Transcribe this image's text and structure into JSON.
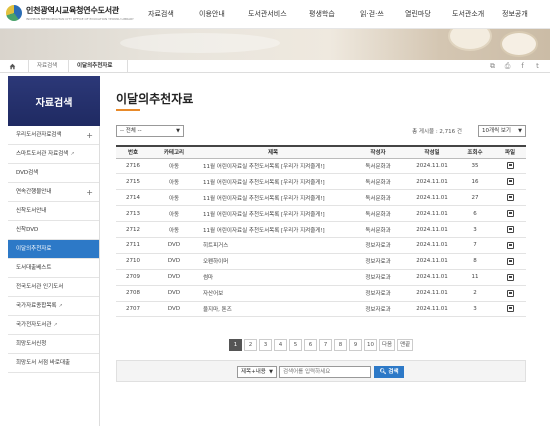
{
  "header": {
    "logo_title": "인천광역시교육청연수도서관",
    "logo_sub": "INCHEON METROPOLITAN CITY OFFICE OF EDUCATION YEONSU LIBRARY",
    "nav": [
      "자료검색",
      "이용안내",
      "도서관서비스",
      "평생학습",
      "읽·걷·쓰",
      "열린마당",
      "도서관소개",
      "정보공개"
    ]
  },
  "breadcrumb": {
    "home_icon": "home-icon",
    "level1": "자료검색",
    "level2": "이달의추천자료"
  },
  "tools": [
    {
      "name": "copy-link-icon",
      "glyph": "⧉"
    },
    {
      "name": "print-icon",
      "glyph": "⎙"
    },
    {
      "name": "facebook-icon",
      "glyph": "f"
    },
    {
      "name": "twitter-icon",
      "glyph": "t"
    }
  ],
  "sidebar": {
    "title": "자료검색",
    "items": [
      {
        "label": "우리도서관자료검색",
        "plus": "+",
        "ext": ""
      },
      {
        "label": "스마트도서관 자료검색",
        "plus": "",
        "ext": "↗"
      },
      {
        "label": "DVD검색",
        "plus": "",
        "ext": ""
      },
      {
        "label": "연속간행물안내",
        "plus": "+",
        "ext": ""
      },
      {
        "label": "신착도서안내",
        "plus": "",
        "ext": ""
      },
      {
        "label": "신착DVD",
        "plus": "",
        "ext": ""
      },
      {
        "label": "이달의추천자료",
        "plus": "",
        "ext": ""
      },
      {
        "label": "도서대출베스트",
        "plus": "",
        "ext": ""
      },
      {
        "label": "전국도서관 인기도서",
        "plus": "",
        "ext": ""
      },
      {
        "label": "국가자료종합목록",
        "plus": "",
        "ext": "↗"
      },
      {
        "label": "국가전자도서관",
        "plus": "",
        "ext": "↗"
      },
      {
        "label": "희망도서신청",
        "plus": "",
        "ext": ""
      },
      {
        "label": "희망도서 서점 바로대출",
        "plus": "",
        "ext": ""
      }
    ]
  },
  "main": {
    "title": "이달의추천자료",
    "category_select": "-- 전체 --",
    "total_label": "총 게시물 : 2,716 건",
    "per_page_select": "10개씩 보기",
    "columns": [
      "번호",
      "카테고리",
      "제목",
      "작성자",
      "작성일",
      "조회수",
      "파일"
    ],
    "rows": [
      {
        "no": "2716",
        "cat": "아동",
        "title": "11월 어린이자료실 추천도서목록 [우리가 지켜줄게!]",
        "author": "독서문화과",
        "date": "2024.11.01",
        "views": "35"
      },
      {
        "no": "2715",
        "cat": "아동",
        "title": "11월 어린이자료실 추천도서목록 [우리가 지켜줄게!]",
        "author": "독서문화과",
        "date": "2024.11.01",
        "views": "16"
      },
      {
        "no": "2714",
        "cat": "아동",
        "title": "11월 어린이자료실 추천도서목록 [우리가 지켜줄게!]",
        "author": "독서문화과",
        "date": "2024.11.01",
        "views": "27"
      },
      {
        "no": "2713",
        "cat": "아동",
        "title": "11월 어린이자료실 추천도서목록 [우리가 지켜줄게!]",
        "author": "독서문화과",
        "date": "2024.11.01",
        "views": "6"
      },
      {
        "no": "2712",
        "cat": "아동",
        "title": "11월 어린이자료실 추천도서목록 [우리가 지켜줄게!]",
        "author": "독서문화과",
        "date": "2024.11.01",
        "views": "3"
      },
      {
        "no": "2711",
        "cat": "DVD",
        "title": "히트피거스",
        "author": "정보자료과",
        "date": "2024.11.01",
        "views": "7"
      },
      {
        "no": "2710",
        "cat": "DVD",
        "title": "오펜하이머",
        "author": "정보자료과",
        "date": "2024.11.01",
        "views": "8"
      },
      {
        "no": "2709",
        "cat": "DVD",
        "title": "썸마",
        "author": "정보자료과",
        "date": "2024.11.01",
        "views": "11"
      },
      {
        "no": "2708",
        "cat": "DVD",
        "title": "자산어보",
        "author": "정보자료과",
        "date": "2024.11.01",
        "views": "2"
      },
      {
        "no": "2707",
        "cat": "DVD",
        "title": "울지마, 톤즈",
        "author": "정보자료과",
        "date": "2024.11.01",
        "views": "3"
      }
    ],
    "pagination": [
      "1",
      "2",
      "3",
      "4",
      "5",
      "6",
      "7",
      "8",
      "9",
      "10",
      "다음",
      "맨끝"
    ],
    "current_page": "1",
    "search": {
      "field_select": "제목+내용",
      "placeholder": "검색어를 입력하세요",
      "button": "검색"
    }
  },
  "colors": {
    "sidebar_title": "#25306b",
    "active": "#2d79c7",
    "accent": "#e88a2a"
  }
}
